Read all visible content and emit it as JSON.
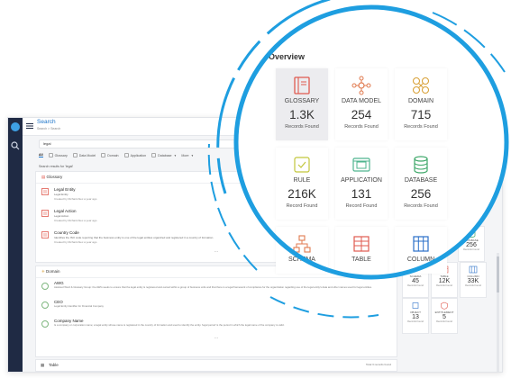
{
  "app": {
    "title": "Search",
    "breadcrumb": "Search > Search",
    "search_value": "legal",
    "filters": [
      {
        "label": "All",
        "active": true
      },
      {
        "label": "Glossary"
      },
      {
        "label": "Data Model"
      },
      {
        "label": "Domain"
      },
      {
        "label": "Application"
      },
      {
        "label": "Database"
      },
      {
        "label": "More"
      }
    ],
    "results_label": "Search results for 'legal'",
    "glossary": {
      "title": "Glossary",
      "rows": [
        {
          "title": "Legal Entity",
          "desc": "Legal Entity",
          "meta": "Created by Richard Alex a year ago"
        },
        {
          "title": "Legal Action",
          "desc": "Legal Action",
          "meta": "Created by Richard Alex a year ago"
        },
        {
          "title": "Country Code",
          "desc": "Identifies the ISO code reporting that the business entity is one of the legal entities organized and registered in a country of formation.",
          "meta": "Created by Richard Alex a year ago"
        }
      ],
      "more": "..."
    },
    "domain": {
      "title": "Domain",
      "rows": [
        {
          "title": "AWG",
          "desc": "Assisted Word & Glossary Group: the AWG seeks to ensure that the legal entity is registered and owned within a group of business units and that there is a legal framework of compliance for the organization regarding use of the legal entity's data and other names used for legal entities."
        },
        {
          "title": "CEO",
          "desc": "Legal Entity Identifier for Financial Company"
        },
        {
          "title": "Company Name",
          "desc": "Is a company or corporation name; a legal entity whose name is registered in the country of formation and used to identify the entity. 'legal period' is the period in which the legal name of the company is valid."
        }
      ],
      "more": "..."
    },
    "table_footer": {
      "label": "Table",
      "count": "Total 3 records found"
    },
    "mini_cards": [
      {
        "label": "DATABASE",
        "value": "256",
        "sub": "Records Found"
      },
      {
        "label": "SCHEMA",
        "value": "45",
        "sub": "Records Found"
      },
      {
        "label": "TABLE",
        "value": "12K",
        "sub": "Records Found"
      },
      {
        "label": "COLUMN",
        "value": "33K",
        "sub": "Records Found"
      },
      {
        "label": "OBJECT",
        "value": "13",
        "sub": "Records Found"
      },
      {
        "label": "ENTITLEMENT",
        "value": "5",
        "sub": "Records Found"
      }
    ]
  },
  "overview": {
    "title": "Overview",
    "cards": [
      {
        "label": "GLOSSARY",
        "value": "1.3K",
        "sub": "Records Found",
        "icon": "book-icon",
        "color": "#e05a4f"
      },
      {
        "label": "DATA MODEL",
        "value": "254",
        "sub": "Records Found",
        "icon": "data-model-icon",
        "color": "#e07a4f"
      },
      {
        "label": "DOMAIN",
        "value": "715",
        "sub": "Records Found",
        "icon": "domain-icon",
        "color": "#d9a23a"
      },
      {
        "label": "RULE",
        "value": "216K",
        "sub": "Record Found",
        "icon": "rule-icon",
        "color": "#c2c63b"
      },
      {
        "label": "APPLICATION",
        "value": "131",
        "sub": "Record Found",
        "icon": "application-icon",
        "color": "#4fb58f"
      },
      {
        "label": "DATABASE",
        "value": "256",
        "sub": "Records Found",
        "icon": "database-icon",
        "color": "#3fa86a"
      },
      {
        "label": "SCHEMA",
        "value": "",
        "sub": "",
        "icon": "schema-icon",
        "color": "#e07a4f"
      },
      {
        "label": "TABLE",
        "value": "",
        "sub": "",
        "icon": "table-icon",
        "color": "#e05a4f"
      },
      {
        "label": "COLUMN",
        "value": "",
        "sub": "",
        "icon": "column-icon",
        "color": "#2a6fc9"
      }
    ]
  },
  "accent": "#1e9ee0"
}
